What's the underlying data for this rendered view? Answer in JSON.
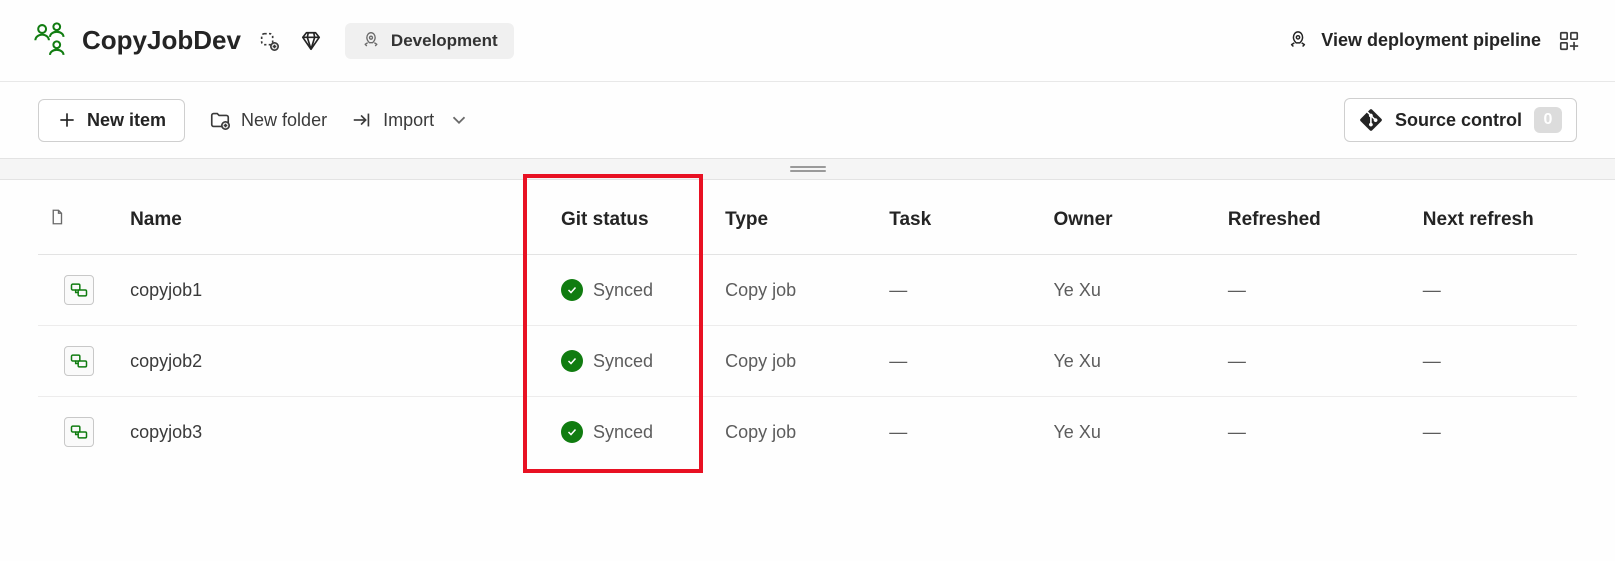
{
  "header": {
    "workspace_title": "CopyJobDev",
    "stage_label": "Development",
    "pipeline_link_label": "View deployment pipeline"
  },
  "toolbar": {
    "new_item_label": "New item",
    "new_folder_label": "New folder",
    "import_label": "Import",
    "source_control_label": "Source control",
    "source_control_count": "0"
  },
  "table": {
    "headers": {
      "name": "Name",
      "git_status": "Git status",
      "type": "Type",
      "task": "Task",
      "owner": "Owner",
      "refreshed": "Refreshed",
      "next_refresh": "Next refresh"
    },
    "rows": [
      {
        "name": "copyjob1",
        "git_status": "Synced",
        "type": "Copy job",
        "task": "—",
        "owner": "Ye Xu",
        "refreshed": "—",
        "next_refresh": "—"
      },
      {
        "name": "copyjob2",
        "git_status": "Synced",
        "type": "Copy job",
        "task": "—",
        "owner": "Ye Xu",
        "refreshed": "—",
        "next_refresh": "—"
      },
      {
        "name": "copyjob3",
        "git_status": "Synced",
        "type": "Copy job",
        "task": "—",
        "owner": "Ye Xu",
        "refreshed": "—",
        "next_refresh": "—"
      }
    ]
  },
  "colors": {
    "synced_green": "#107c10",
    "highlight_red": "#e81123"
  }
}
